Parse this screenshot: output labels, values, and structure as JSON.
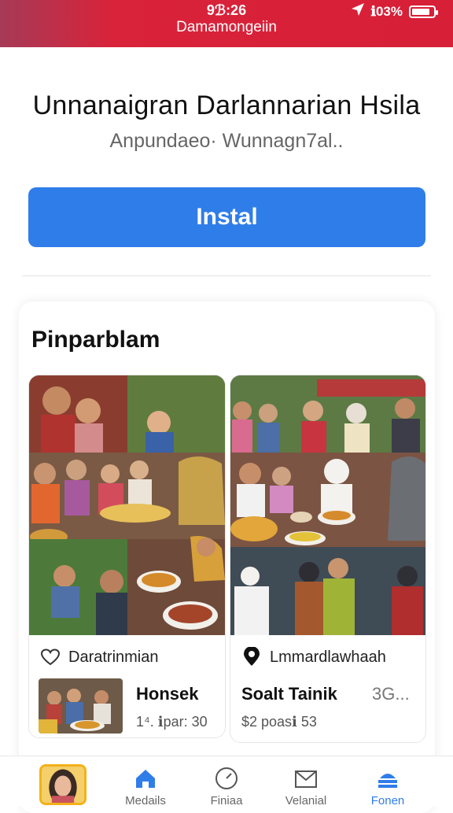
{
  "status_bar": {
    "time": "9ℬ:26",
    "carrier": "Damamongeiin",
    "battery_text": "ℹ03%",
    "colors": {
      "bar": "#d71f38"
    }
  },
  "app": {
    "title": "Unnanaigran Darlannarian Hsila",
    "subtitle": "Anpundaeo· Wunnagn7al.."
  },
  "install_button": {
    "label": "Instal",
    "color": "#2f7de9"
  },
  "section": {
    "title": "Pinparblam",
    "cards": [
      {
        "label": "Daratrinmian",
        "label_icon": "heart-icon",
        "price_title": "Honsek",
        "price_sub": "1⁴. ℹpar: 30"
      },
      {
        "label": "Lmmardlawhaah",
        "label_icon": "location-pin-icon",
        "price_title": "Soalt Tainik",
        "price_sub": "$2 poasℹ 53",
        "price_extra": "3G..."
      }
    ]
  },
  "tab_bar": {
    "tabs": [
      {
        "label": "",
        "icon": "avatar"
      },
      {
        "label": "Medails",
        "icon": "home-icon"
      },
      {
        "label": "Finiaa",
        "icon": "clock-icon"
      },
      {
        "label": "Velanial",
        "icon": "mail-icon"
      },
      {
        "label": "Fonen",
        "icon": "profile-icon",
        "active": true
      }
    ]
  }
}
